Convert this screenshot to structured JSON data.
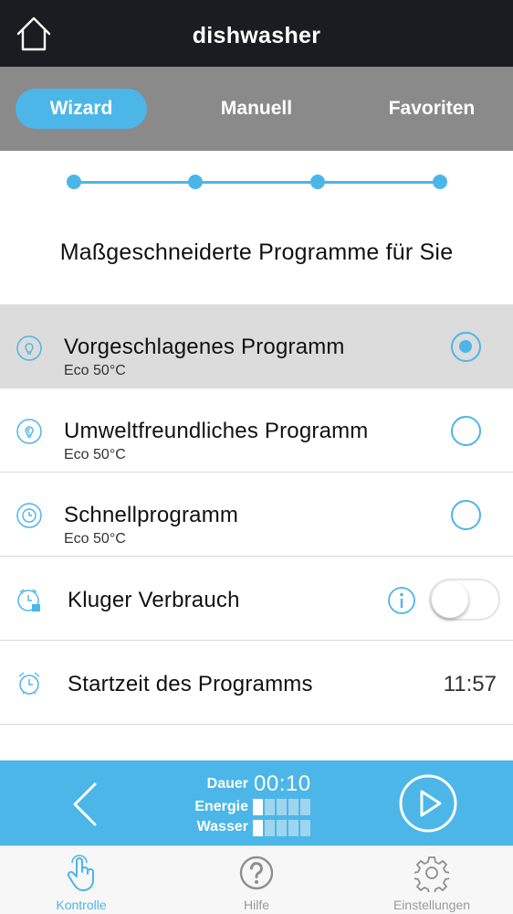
{
  "app": {
    "title": "dishwasher"
  },
  "modes": {
    "tabs": [
      {
        "label": "Wizard",
        "active": true
      },
      {
        "label": "Manuell",
        "active": false
      },
      {
        "label": "Favoriten",
        "active": false
      }
    ]
  },
  "wizard": {
    "steps_total": 4,
    "headline": "Maßgeschneiderte Programme für Sie"
  },
  "programs": [
    {
      "title": "Vorgeschlagenes Programm",
      "subtitle": "Eco 50°C",
      "icon": "lightbulb-icon",
      "selected": true
    },
    {
      "title": "Umweltfreundliches Programm",
      "subtitle": "Eco 50°C",
      "icon": "leaf-bulb-icon",
      "selected": false
    },
    {
      "title": "Schnellprogramm",
      "subtitle": "Eco 50°C",
      "icon": "clock-icon",
      "selected": false
    }
  ],
  "options": {
    "smart_usage": {
      "label": "Kluger Verbrauch",
      "icon": "smart-clock-icon",
      "enabled": false
    },
    "start_time": {
      "label": "Startzeit des Programms",
      "icon": "alarm-clock-icon",
      "value": "11:57"
    }
  },
  "summary": {
    "dauer_label": "Dauer",
    "dauer_value": "00:10",
    "energie_label": "Energie",
    "energie_level": 1,
    "wasser_label": "Wasser",
    "wasser_level": 1,
    "level_max": 5
  },
  "tabbar": {
    "items": [
      {
        "label": "Kontrolle",
        "icon": "touch-hand-icon",
        "active": true
      },
      {
        "label": "Hilfe",
        "icon": "help-icon",
        "active": false
      },
      {
        "label": "Einstellungen",
        "icon": "gear-icon",
        "active": false
      }
    ]
  },
  "colors": {
    "accent": "#4cb6e8",
    "header": "#1b1c22",
    "modebar": "#8a8a8a",
    "selected_row": "#dcdcdc"
  }
}
